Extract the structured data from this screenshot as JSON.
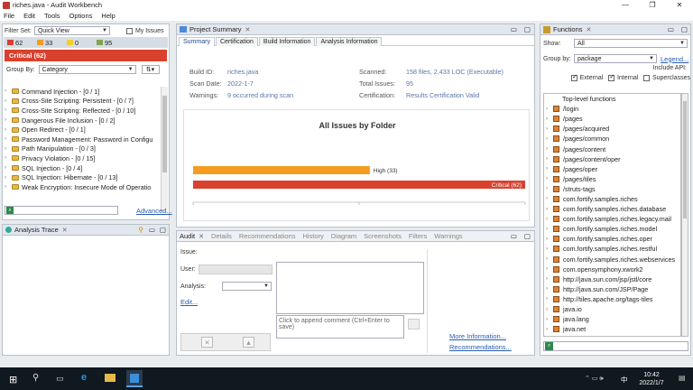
{
  "window": {
    "title": "riches.java - Audit Workbench"
  },
  "menu": [
    "File",
    "Edit",
    "Tools",
    "Options",
    "Help"
  ],
  "left": {
    "filter_set_label": "Filter Set:",
    "filter_set_value": "Quick View",
    "my_issues_label": "My Issues",
    "counts": [
      {
        "value": "62",
        "color": "#d9412f"
      },
      {
        "value": "33",
        "color": "#f39c1f"
      },
      {
        "value": "0",
        "color": "#f2d027"
      },
      {
        "value": "95",
        "color": "#7fa64a"
      }
    ],
    "critical_banner": "Critical (62)",
    "group_by_label": "Group By:",
    "group_by_value": "Category",
    "issues": [
      "Command Injection - [0 / 1]",
      "Cross-Site Scripting: Persistent - [0 / 7]",
      "Cross-Site Scripting: Reflected - [0 / 10]",
      "Dangerous File Inclusion - [0 / 2]",
      "Open Redirect - [0 / 1]",
      "Password Management: Password in Configu",
      "Path Manipulation - [0 / 3]",
      "Privacy Violation - [0 / 15]",
      "SQL Injection - [0 / 4]",
      "SQL Injection: Hibernate - [0 / 13]",
      "Weak Encryption: Insecure Mode of Operatio"
    ],
    "advanced_link": "Advanced...",
    "analysis_trace_title": "Analysis Trace"
  },
  "summary": {
    "view_title": "Project Summary",
    "tabs": [
      "Summary",
      "Certification",
      "Build Information",
      "Analysis Information"
    ],
    "build_id_label": "Build ID:",
    "build_id": "riches.java",
    "scan_date_label": "Scan Date:",
    "scan_date": "2022-1-7",
    "warnings_label": "Warnings:",
    "warnings": "9 occurred during scan",
    "scanned_label": "Scanned:",
    "scanned": "158 files, 2,433 LOC (Executable)",
    "total_issues_label": "Total Issues:",
    "total_issues": "95",
    "certification_label": "Certification:",
    "certification": "Results Certification Valid"
  },
  "chart_data": {
    "type": "bar",
    "title": "All Issues by Folder",
    "orientation": "horizontal",
    "categories": [
      "High",
      "Critical"
    ],
    "values": [
      33,
      62
    ],
    "labels": [
      "High (33)",
      "Critical (62)"
    ],
    "colors": [
      "#f39c1f",
      "#d9412f"
    ],
    "xlim": [
      0,
      62
    ]
  },
  "audit": {
    "tabs": [
      "Audit",
      "Details",
      "Recommendations",
      "History",
      "Diagram",
      "Screenshots",
      "Filters",
      "Warnings"
    ],
    "issue_label": "Issue:",
    "user_label": "User:",
    "analysis_label": "Analysis:",
    "edit_link": "Edit...",
    "comment_placeholder": "Click to append comment (Ctrl+Enter to save)",
    "more_info_link": "More Information...",
    "recommendations_link": "Recommendations..."
  },
  "functions": {
    "title": "Functions",
    "show_label": "Show:",
    "show_value": "All",
    "group_by_label": "Group by:",
    "group_by_value": "package",
    "legend_link": "Legend...",
    "include_api_label": "Include API:",
    "external_label": "External",
    "internal_label": "Internal",
    "superclasses_label": "Superclasses",
    "items": [
      "Top-level functions",
      "/login",
      "/pages",
      "/pages/acquired",
      "/pages/common",
      "/pages/content",
      "/pages/content/oper",
      "/pages/oper",
      "/pages/tiles",
      "/struts-tags",
      "com.fortify.samples.riches",
      "com.fortify.samples.riches.database",
      "com.fortify.samples.riches.legacy.mail",
      "com.fortify.samples.riches.model",
      "com.fortify.samples.riches.oper",
      "com.fortify.samples.riches.restful",
      "com.fortify.samples.riches.webservices",
      "com.opensymphony.xwork2",
      "http://java.sun.com/jsp/jstl/core",
      "http://java.sun.com/JSP/Page",
      "http://tiles.apache.org/tags-tiles",
      "java.io",
      "java.lang",
      "java.net"
    ]
  },
  "taskbar": {
    "time": "10:42",
    "date": "2022/1/7",
    "lang": "中"
  }
}
